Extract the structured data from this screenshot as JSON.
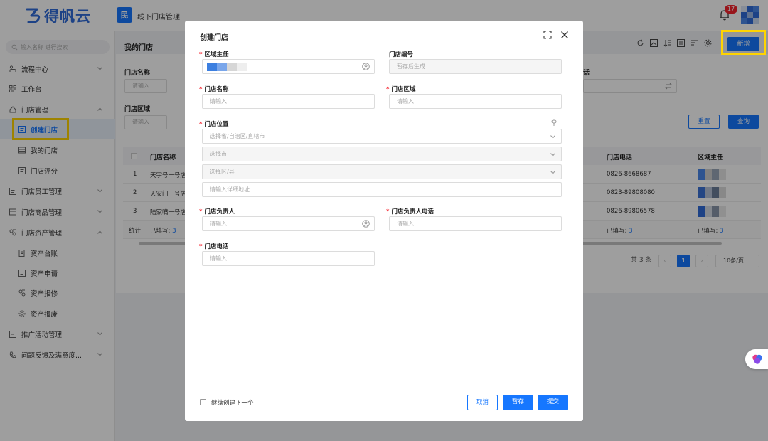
{
  "topbar": {
    "logo_text": "得帆云",
    "app_icon_text": "民",
    "app_title": "线下门店管理",
    "notification_count": "17"
  },
  "sidebar": {
    "search_placeholder": "输入名称 进行搜索",
    "items": [
      {
        "label": "流程中心",
        "icon": "flow-icon",
        "expandable": true
      },
      {
        "label": "工作台",
        "icon": "grid-icon",
        "expandable": false
      },
      {
        "label": "门店管理",
        "icon": "home-icon",
        "expandable": true,
        "expanded": true
      },
      {
        "label": "创建门店",
        "icon": "form-icon",
        "sub": true,
        "active": true
      },
      {
        "label": "我的门店",
        "icon": "list-icon",
        "sub": true
      },
      {
        "label": "门店评分",
        "icon": "form-icon",
        "sub": true
      },
      {
        "label": "门店员工管理",
        "icon": "form-icon",
        "expandable": true
      },
      {
        "label": "门店商品管理",
        "icon": "list-icon",
        "expandable": true
      },
      {
        "label": "门店资产管理",
        "icon": "asset-icon",
        "expandable": true,
        "expanded": true
      },
      {
        "label": "资产台账",
        "icon": "ledger-icon",
        "sub": true
      },
      {
        "label": "资产申请",
        "icon": "form-icon",
        "sub": true
      },
      {
        "label": "资产报修",
        "icon": "asset-icon",
        "sub": true
      },
      {
        "label": "资产报废",
        "icon": "gear-icon",
        "sub": true
      },
      {
        "label": "推广活动管理",
        "icon": "doc-icon",
        "expandable": true
      },
      {
        "label": "问题反馈及满意度...",
        "icon": "phone-icon",
        "expandable": true
      }
    ]
  },
  "main": {
    "title": "我的门店",
    "new_button": "新增",
    "filters": {
      "store_name_label": "门店名称",
      "store_name_placeholder": "请输入",
      "store_area_label": "门店区域",
      "store_area_placeholder": "请输入",
      "phone_label_partial": "话"
    },
    "reset_button": "重置",
    "query_button": "查询",
    "table": {
      "columns": [
        "门店名称",
        "门店电话",
        "区域主任"
      ],
      "rows": [
        {
          "index": "1",
          "name": "天宇号一号店",
          "phone": "0826-8668687"
        },
        {
          "index": "2",
          "name": "天安门一号店",
          "phone": "0823-89808080"
        },
        {
          "index": "3",
          "name": "陆家嘴一号店",
          "phone": "0826-89806578"
        }
      ],
      "footer": {
        "label": "统计",
        "filled_label": "已填写:",
        "filled_count": "3"
      }
    },
    "pagination": {
      "total_text": "共 3 条",
      "current_page": "1",
      "page_size": "10条/页"
    }
  },
  "modal": {
    "title": "创建门店",
    "fields": {
      "area_director": {
        "label": "区域主任",
        "required": true
      },
      "store_code": {
        "label": "门店编号",
        "required": false,
        "placeholder": "暂存后生成"
      },
      "store_name": {
        "label": "门店名称",
        "required": true,
        "placeholder": "请输入"
      },
      "store_area": {
        "label": "门店区域",
        "required": true,
        "placeholder": "请输入"
      },
      "store_location": {
        "label": "门店位置",
        "required": true,
        "province_placeholder": "选择省/自治区/直辖市",
        "city_placeholder": "选择市",
        "district_placeholder": "选择区/县",
        "address_placeholder": "请输入详细地址"
      },
      "store_manager": {
        "label": "门店负责人",
        "required": true,
        "placeholder": "请输入"
      },
      "manager_phone": {
        "label": "门店负责人电话",
        "required": true,
        "placeholder": "请输入"
      },
      "store_phone": {
        "label": "门店电话",
        "required": true,
        "placeholder": "请输入"
      }
    },
    "continue_checkbox_label": "继续创建下一个",
    "cancel_button": "取消",
    "save_draft_button": "暂存",
    "submit_button": "提交"
  },
  "colors": {
    "primary": "#1677ff",
    "highlight": "#ffd400",
    "danger": "#f5222d",
    "logo": "#2f6bd9"
  }
}
